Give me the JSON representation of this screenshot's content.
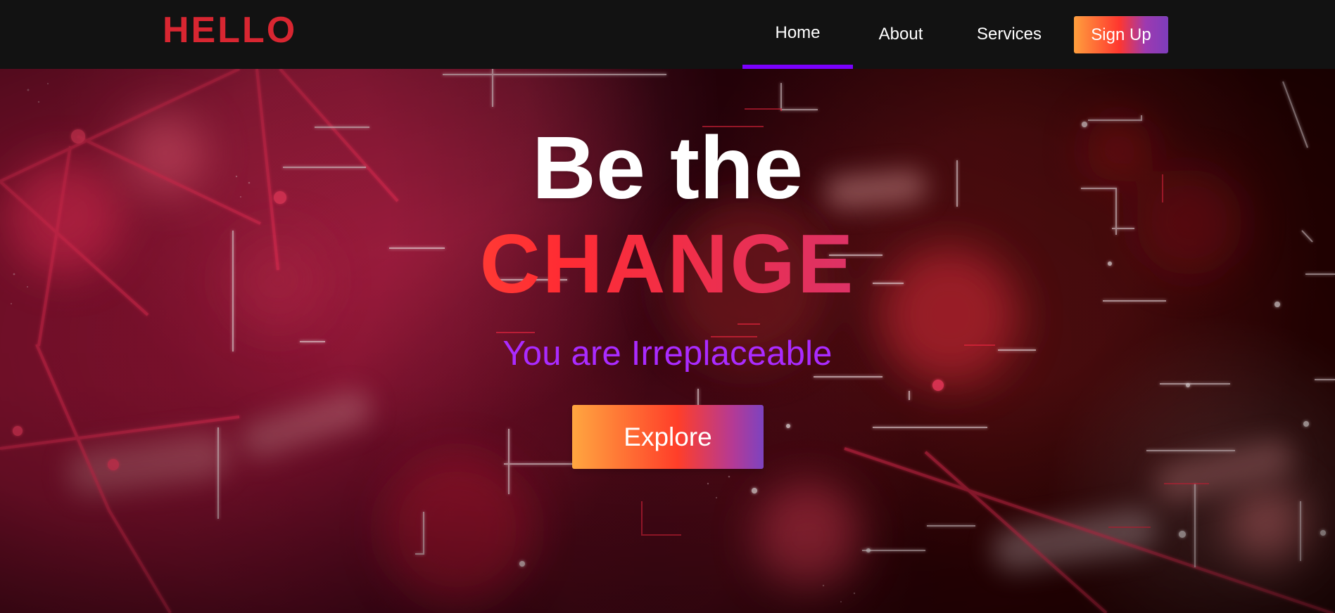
{
  "header": {
    "logo": "HELLO",
    "nav_items": [
      {
        "label": "Home",
        "active": true
      },
      {
        "label": "About",
        "active": false
      },
      {
        "label": "Services",
        "active": false
      }
    ],
    "signup_label": "Sign Up"
  },
  "hero": {
    "title": "Be the",
    "highlight": "CHANGE",
    "subtitle": "You are Irreplaceable",
    "button_label": "Explore"
  },
  "colors": {
    "nav_background": "#121212",
    "logo": "#d82631",
    "active_nav_underline": "#7a00ff",
    "subtitle": "#aa2bff",
    "gradient_start": "#ffa33d",
    "gradient_middle": "#ff2c33",
    "gradient_end": "#9a3fc5"
  }
}
